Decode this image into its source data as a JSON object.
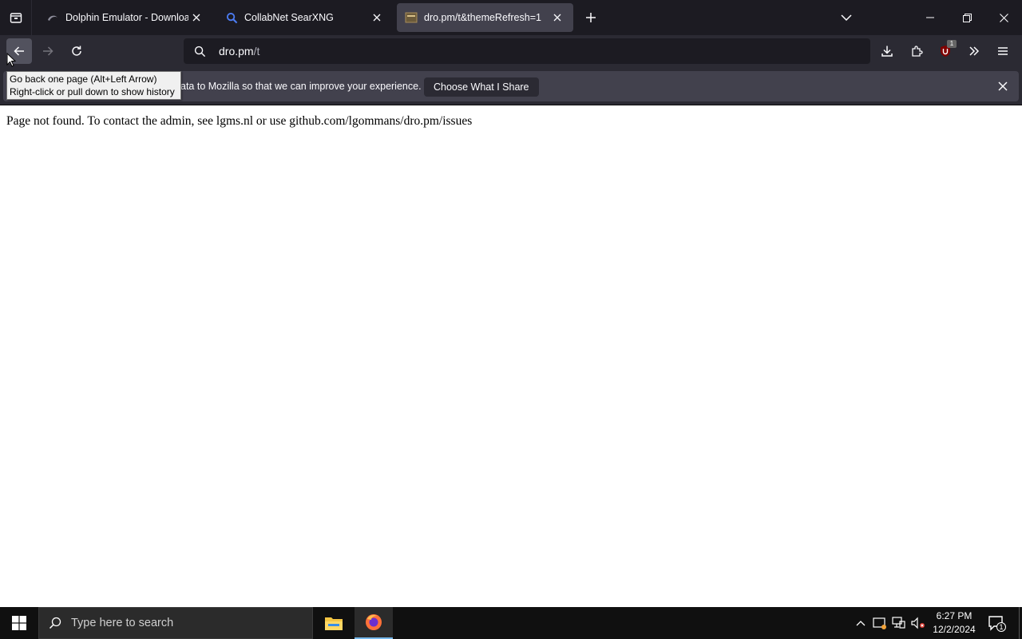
{
  "tabs": [
    {
      "label": "Dolphin Emulator - Download",
      "favicon": "dolphin-icon",
      "active": false
    },
    {
      "label": "CollabNet SearXNG",
      "favicon": "search-icon",
      "active": false
    },
    {
      "label": "dro.pm/t&themeRefresh=1",
      "favicon": "page-icon",
      "active": true
    }
  ],
  "urlbar": {
    "host": "dro.pm",
    "path": "/t"
  },
  "extensions_badge": "1",
  "notification": {
    "text": "ata to Mozilla so that we can improve your experience.",
    "button_label": "Choose What I Share"
  },
  "tooltip": {
    "line1": "Go back one page (Alt+Left Arrow)",
    "line2": "Right-click or pull down to show history"
  },
  "page": {
    "message": "Page not found. To contact the admin, see lgms.nl or use github.com/lgommans/dro.pm/issues"
  },
  "taskbar": {
    "search_placeholder": "Type here to search",
    "time": "6:27 PM",
    "date": "12/2/2024",
    "notification_count": "1"
  },
  "colors": {
    "tabstrip_bg": "#1c1b22",
    "toolbar_bg": "#2b2a33",
    "active_tab_bg": "#42414d",
    "taskbar_bg": "#101010"
  }
}
